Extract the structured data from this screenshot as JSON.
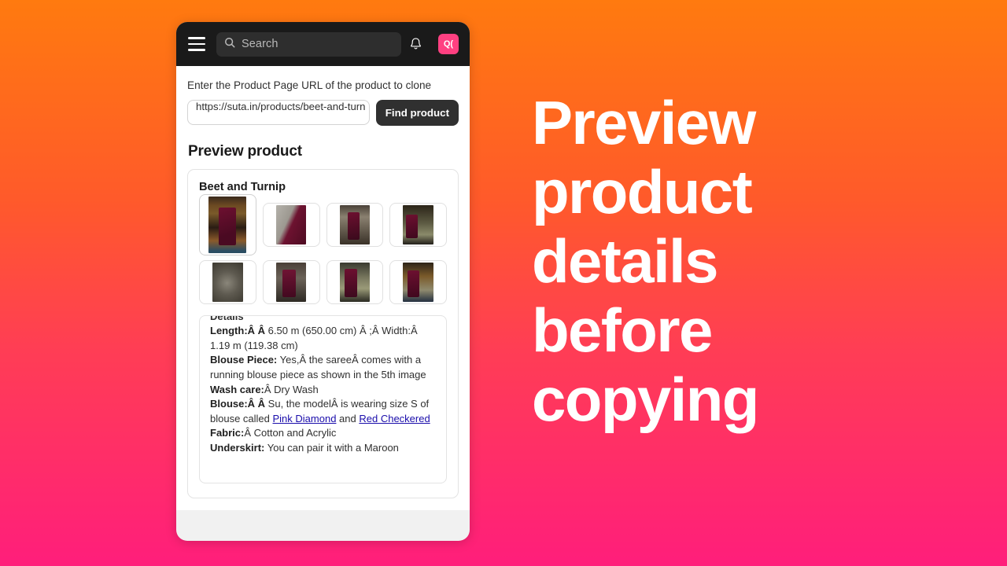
{
  "topbar": {
    "menu_icon": "hamburger-menu-icon",
    "search_placeholder": "Search",
    "search_icon": "search-icon",
    "notification_icon": "bell-icon",
    "avatar_initials": "Q("
  },
  "form": {
    "url_label": "Enter the Product Page URL of the product to clone",
    "url_value": "https://suta.in/products/beet-and-turn",
    "url_placeholder": "https://",
    "find_button": "Find product"
  },
  "preview": {
    "section_title": "Preview product",
    "product_title": "Beet and Turnip",
    "thumbnails": [
      {
        "alt": "model-in-maroon-saree-doorway",
        "selected": true
      },
      {
        "alt": "saree-fabric-closeup-maroon-grey",
        "selected": false
      },
      {
        "alt": "model-draping-olive-maroon-saree",
        "selected": false
      },
      {
        "alt": "model-side-pose-olive-pallu",
        "selected": false
      },
      {
        "alt": "swirled-grey-fabric-texture",
        "selected": false
      },
      {
        "alt": "model-indoor-maroon-saree",
        "selected": false
      },
      {
        "alt": "model-seated-chair-maroon-saree",
        "selected": false
      },
      {
        "alt": "model-outdoor-maroon-olive-saree",
        "selected": false
      }
    ],
    "details": {
      "heading": "Details",
      "lines": [
        {
          "label": "Length:Â Â",
          "value": " 6.50 m (650.00 cm) Â ;Â Width:Â 1.19 m (119.38 cm)"
        },
        {
          "label": "Blouse Piece:",
          "value": " Yes,Â the sareeÂ comes with a running blouse piece as shown in the 5th image"
        },
        {
          "label": "Wash care:",
          "value": "Â Dry Wash"
        },
        {
          "label": "Blouse:Â Â",
          "value": " Su, the modelÂ is wearing size S of blouse called "
        },
        {
          "label": "Fabric:",
          "value": "Â Cotton and Acrylic"
        },
        {
          "label": "Underskirt:",
          "value": " You can pair it with a Maroon"
        }
      ],
      "link_one": "Pink Diamond",
      "link_conjunction": " and ",
      "link_two": "Red Checkered"
    }
  },
  "marketing": {
    "headline": "Preview product details before copying"
  },
  "colors": {
    "gradient_top": "#FF7A0F",
    "gradient_bottom": "#FF1E7B",
    "topbar_bg": "#1A1A1A",
    "avatar_bg": "#FF4081",
    "button_bg": "#303030",
    "link": "#1A0DAB"
  }
}
